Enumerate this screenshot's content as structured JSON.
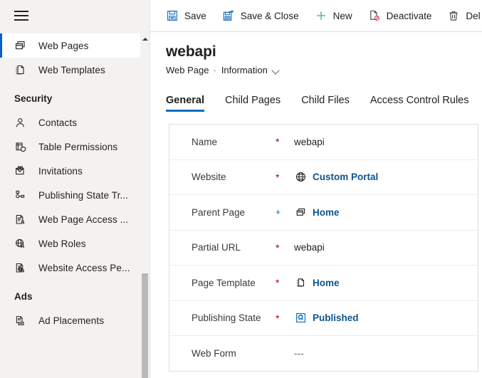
{
  "sidebar": {
    "menu_icon": "hamburger-icon",
    "scroll": {
      "up_arrow": "scroll-up-arrow"
    },
    "items": [
      {
        "label": "Web Pages",
        "icon": "web-pages-icon",
        "selected": true,
        "type": "item"
      },
      {
        "label": "Web Templates",
        "icon": "web-templates-icon",
        "selected": false,
        "type": "item"
      },
      {
        "label": "Security",
        "icon": "",
        "selected": false,
        "type": "group"
      },
      {
        "label": "Contacts",
        "icon": "contact-person-icon",
        "selected": false,
        "type": "item"
      },
      {
        "label": "Table  Permissions",
        "icon": "table-permissions-icon",
        "selected": false,
        "type": "item"
      },
      {
        "label": "Invitations",
        "icon": "invitations-envelope-icon",
        "selected": false,
        "type": "item"
      },
      {
        "label": "Publishing State Tr...",
        "icon": "publishing-state-transition-icon",
        "selected": false,
        "type": "item"
      },
      {
        "label": "Web Page Access ...",
        "icon": "web-page-access-icon",
        "selected": false,
        "type": "item"
      },
      {
        "label": "Web Roles",
        "icon": "web-roles-globe-icon",
        "selected": false,
        "type": "item"
      },
      {
        "label": "Website Access Pe...",
        "icon": "website-access-icon",
        "selected": false,
        "type": "item"
      },
      {
        "label": "Ads",
        "icon": "",
        "selected": false,
        "type": "group"
      },
      {
        "label": "Ad Placements",
        "icon": "ad-placements-icon",
        "selected": false,
        "type": "item"
      }
    ]
  },
  "commandbar": {
    "buttons": [
      {
        "label": "Save",
        "icon": "save-disk-icon"
      },
      {
        "label": "Save & Close",
        "icon": "save-and-close-icon"
      },
      {
        "label": "New",
        "icon": "plus-icon"
      },
      {
        "label": "Deactivate",
        "icon": "deactivate-icon"
      },
      {
        "label": "Del",
        "icon": "delete-trash-icon"
      }
    ]
  },
  "record": {
    "title": "webapi",
    "entity": "Web Page",
    "separator": "·",
    "form_name": "Information",
    "form_chevron": "chevron-down-icon"
  },
  "tabs": [
    {
      "label": "General",
      "active": true
    },
    {
      "label": "Child Pages",
      "active": false
    },
    {
      "label": "Child Files",
      "active": false
    },
    {
      "label": "Access Control Rules",
      "active": false
    }
  ],
  "form": {
    "fields": [
      {
        "label": "Name",
        "required": "*",
        "required_kind": "asterisk",
        "icon": "",
        "value": "webapi",
        "value_kind": "text"
      },
      {
        "label": "Website",
        "required": "*",
        "required_kind": "asterisk",
        "icon": "globe-icon",
        "value": "Custom Portal",
        "value_kind": "link"
      },
      {
        "label": "Parent Page",
        "required": "+",
        "required_kind": "plus",
        "icon": "web-pages-icon",
        "value": "Home",
        "value_kind": "link"
      },
      {
        "label": "Partial URL",
        "required": "*",
        "required_kind": "asterisk",
        "icon": "",
        "value": "webapi",
        "value_kind": "text"
      },
      {
        "label": "Page Template",
        "required": "*",
        "required_kind": "asterisk",
        "icon": "page-template-icon",
        "value": "Home",
        "value_kind": "link"
      },
      {
        "label": "Publishing State",
        "required": "*",
        "required_kind": "asterisk",
        "icon": "publishing-state-icon",
        "value": "Published",
        "value_kind": "link"
      },
      {
        "label": "Web Form",
        "required": "",
        "required_kind": "none",
        "icon": "",
        "value": "---",
        "value_kind": "empty"
      }
    ]
  },
  "colors": {
    "accent_blue": "#0f6cbd",
    "link_blue": "#0f548c",
    "selected_bar": "#0b5ccd",
    "required_red": "#a80000",
    "sidebar_bg": "#f3f2f1",
    "new_green": "#5bb98c"
  }
}
